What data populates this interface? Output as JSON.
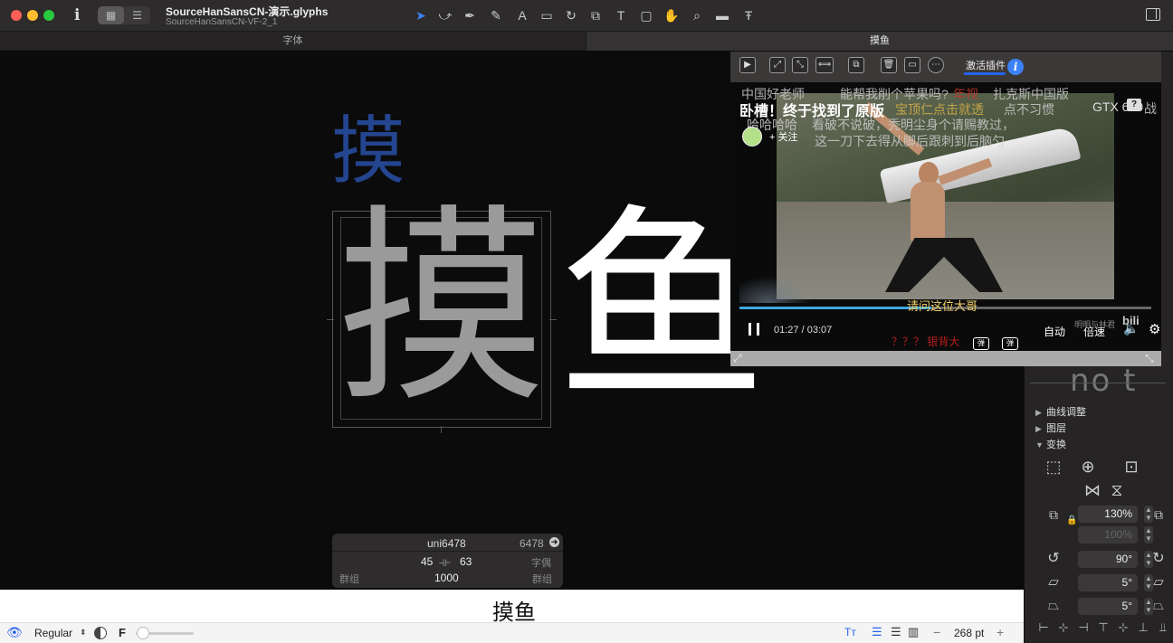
{
  "window": {
    "doc_title": "SourceHanSansCN-演示.glyphs",
    "doc_subtitle": "SourceHanSansCN-VF-2_1",
    "info_icon": "i"
  },
  "toolbar": {
    "view_grid_icon": "▦",
    "view_list_icon": "☰",
    "tools": [
      "➤",
      "⤻",
      "✒",
      "✎",
      "A",
      "▭",
      "↻",
      "⧉",
      "T",
      "▢",
      "✋",
      "⌕",
      "▬",
      "Ŧ"
    ],
    "tool_names": [
      "select-tool",
      "select-all-layers-tool",
      "draw-tool",
      "pencil-tool",
      "annotate-tool",
      "rectangle-tool",
      "rotate-tool",
      "scale-tool",
      "text-tool",
      "comment-tool",
      "hand-tool",
      "zoom-tool",
      "measure-tool",
      "kern-tool"
    ]
  },
  "tabs": [
    {
      "label": "字体"
    },
    {
      "label": "摸鱼"
    }
  ],
  "canvas": {
    "preview_glyph": "摸",
    "active_glyph": "摸",
    "next_glyph": "鱼"
  },
  "info_panel": {
    "glyph_name": "uni6478",
    "unicode": "6478",
    "lsb": "45",
    "rsb": "63",
    "kerning_label": "字偶",
    "group_left": "群组",
    "width": "1000",
    "group_right": "群组"
  },
  "preview": {
    "text": "摸鱼"
  },
  "bottom_bar": {
    "master": "Regular",
    "font_icon": "F",
    "point_size": "268 pt",
    "minus": "−",
    "plus": "+"
  },
  "sidebar": {
    "ghost_text": "no t",
    "sections": [
      {
        "label": "曲线调整",
        "expanded": false
      },
      {
        "label": "图层",
        "expanded": false
      },
      {
        "label": "变换",
        "expanded": true
      }
    ],
    "scale_x": "130%",
    "scale_y": "100%",
    "rotate": "90°",
    "slant": "5°",
    "skew": "5°"
  },
  "video": {
    "toolbar": {
      "activate_label": "激活插件",
      "info_icon": "i"
    },
    "title": "卧槽！终于找到了原版",
    "follow_label": "+ 关注",
    "danmaku": [
      "中国好老师",
      "能帮我削个苹果吗?",
      "年视",
      "扎克斯中国版",
      "哈哈哈哈",
      "看破不说破，秃明尘身个请赐教过，",
      "这一刀下去得从脚后跟刺到后脑勺",
      "宝顶仁点击就透",
      "点不习惯",
      "GTX 680",
      "战"
    ],
    "subtitle": "请问这位大哥",
    "time_current": "01:27",
    "time_separator": "/",
    "time_total": "03:07",
    "auto_label": "自动",
    "speed_label": "倍速",
    "red_danmaku": "？？？ 银背大",
    "watermark": "明明与林君",
    "bili_logo": "bilibili",
    "danmaku_toggle": "弹",
    "danmaku_settings": "弹",
    "help_icon": "?",
    "progress": 0.4652
  }
}
